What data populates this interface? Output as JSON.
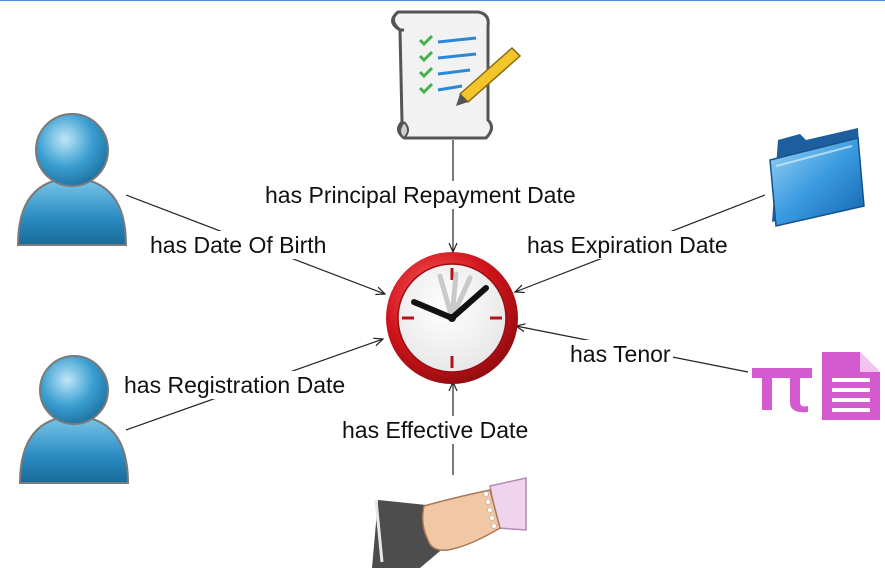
{
  "colors": {
    "top_rule": "#4a90d9",
    "person": "#2b8fc4",
    "folder": "#2a7fc9",
    "pi_doc": "#d45ad0",
    "clock_rim": "#c8161d",
    "line": "#222222"
  },
  "icons": {
    "center": "clock-icon",
    "top": "checklist-scroll-icon",
    "left_top": "person-icon",
    "left_bottom": "person-icon",
    "right_top": "folder-icon",
    "right_middle": "pi-document-icon",
    "bottom": "handshake-icon"
  },
  "labels": {
    "principal": "has Principal Repayment Date",
    "birth": "has Date Of Birth",
    "expiration": "has Expiration Date",
    "tenor": "has Tenor",
    "registration": "has Registration Date",
    "effective": "has Effective Date"
  }
}
